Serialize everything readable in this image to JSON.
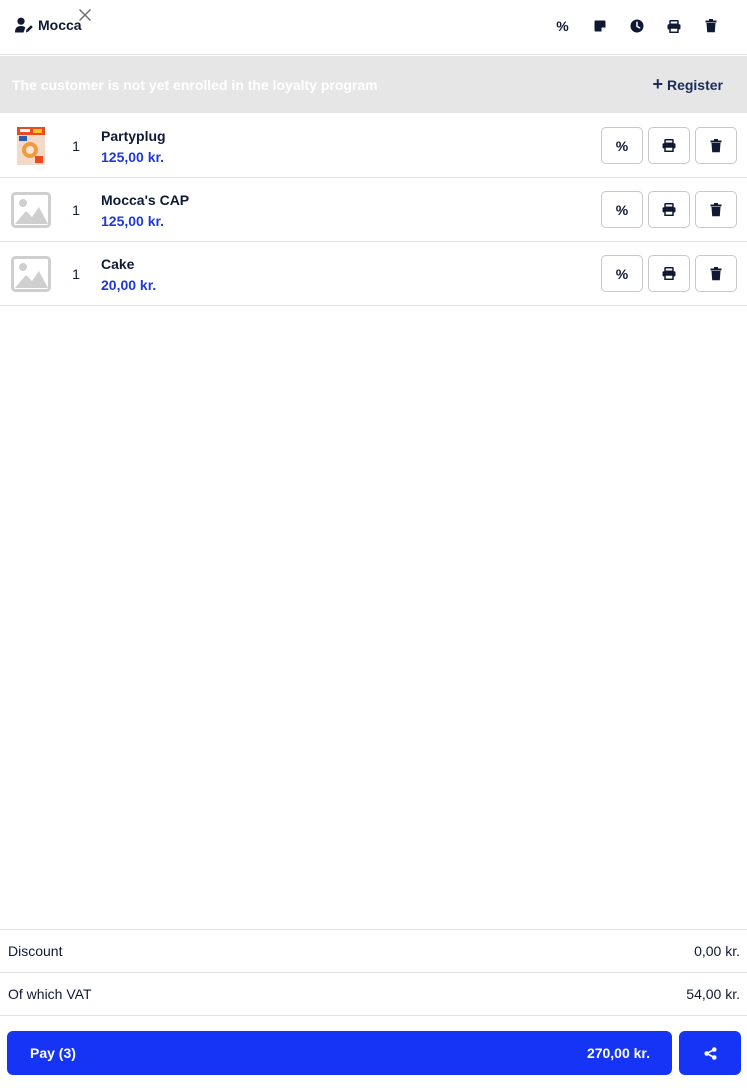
{
  "header": {
    "customer_name": "Mocca",
    "icons": [
      "user-edit-icon",
      "close-icon",
      "percent-icon",
      "note-icon",
      "clock-icon",
      "printer-icon",
      "trash-icon"
    ],
    "discount_label": "%"
  },
  "loyalty": {
    "message": "The customer is not yet enrolled in the loyalty program",
    "register_label": "Register"
  },
  "items": [
    {
      "qty": "1",
      "name": "Partyplug",
      "price": "125,00 kr.",
      "has_image": true
    },
    {
      "qty": "1",
      "name": "Mocca's CAP",
      "price": "125,00 kr.",
      "has_image": false
    },
    {
      "qty": "1",
      "name": "Cake",
      "price": "20,00 kr.",
      "has_image": false
    }
  ],
  "item_actions": {
    "discount_label": "%"
  },
  "totals": {
    "discount_label": "Discount",
    "discount_value": "0,00 kr.",
    "vat_label": "Of which VAT",
    "vat_value": "54,00 kr."
  },
  "pay": {
    "label": "Pay (3)",
    "amount": "270,00 kr."
  },
  "colors": {
    "accent": "#1534f5",
    "price": "#1d3ad8",
    "text": "#0f1934",
    "banner_bg": "#e6e6e6"
  }
}
